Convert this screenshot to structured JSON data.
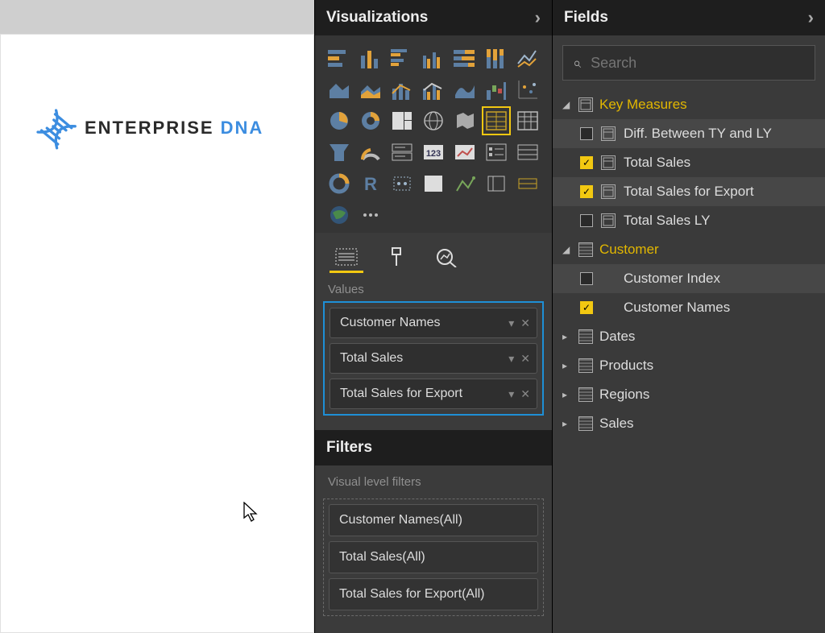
{
  "canvas": {
    "logo_word1": "ENTERPRISE",
    "logo_word2": "DNA"
  },
  "viz_panel": {
    "title": "Visualizations",
    "values_label": "Values",
    "values": [
      {
        "label": "Customer Names"
      },
      {
        "label": "Total Sales"
      },
      {
        "label": "Total Sales for Export"
      }
    ],
    "filters_title": "Filters",
    "visual_filters_label": "Visual level filters",
    "visual_filters": [
      {
        "label": "Customer Names(All)"
      },
      {
        "label": "Total Sales(All)"
      },
      {
        "label": "Total Sales for Export(All)"
      }
    ]
  },
  "fields_panel": {
    "title": "Fields",
    "search_placeholder": "Search",
    "groups": [
      {
        "name": "Key Measures",
        "expanded": true,
        "icon": "calc",
        "items": [
          {
            "label": "Diff. Between TY and LY",
            "checked": false,
            "icon": "calc",
            "shaded": true
          },
          {
            "label": "Total Sales",
            "checked": true,
            "icon": "calc",
            "shaded": false
          },
          {
            "label": "Total Sales for Export",
            "checked": true,
            "icon": "calc",
            "shaded": true
          },
          {
            "label": "Total Sales LY",
            "checked": false,
            "icon": "calc",
            "shaded": false
          }
        ]
      },
      {
        "name": "Customer",
        "expanded": true,
        "icon": "table",
        "items": [
          {
            "label": "Customer Index",
            "checked": false,
            "icon": "none",
            "shaded": true
          },
          {
            "label": "Customer Names",
            "checked": true,
            "icon": "none",
            "shaded": false
          }
        ]
      },
      {
        "name": "Dates",
        "expanded": false,
        "icon": "table",
        "items": []
      },
      {
        "name": "Products",
        "expanded": false,
        "icon": "table",
        "items": []
      },
      {
        "name": "Regions",
        "expanded": false,
        "icon": "table",
        "items": []
      },
      {
        "name": "Sales",
        "expanded": false,
        "icon": "table",
        "items": []
      }
    ]
  }
}
